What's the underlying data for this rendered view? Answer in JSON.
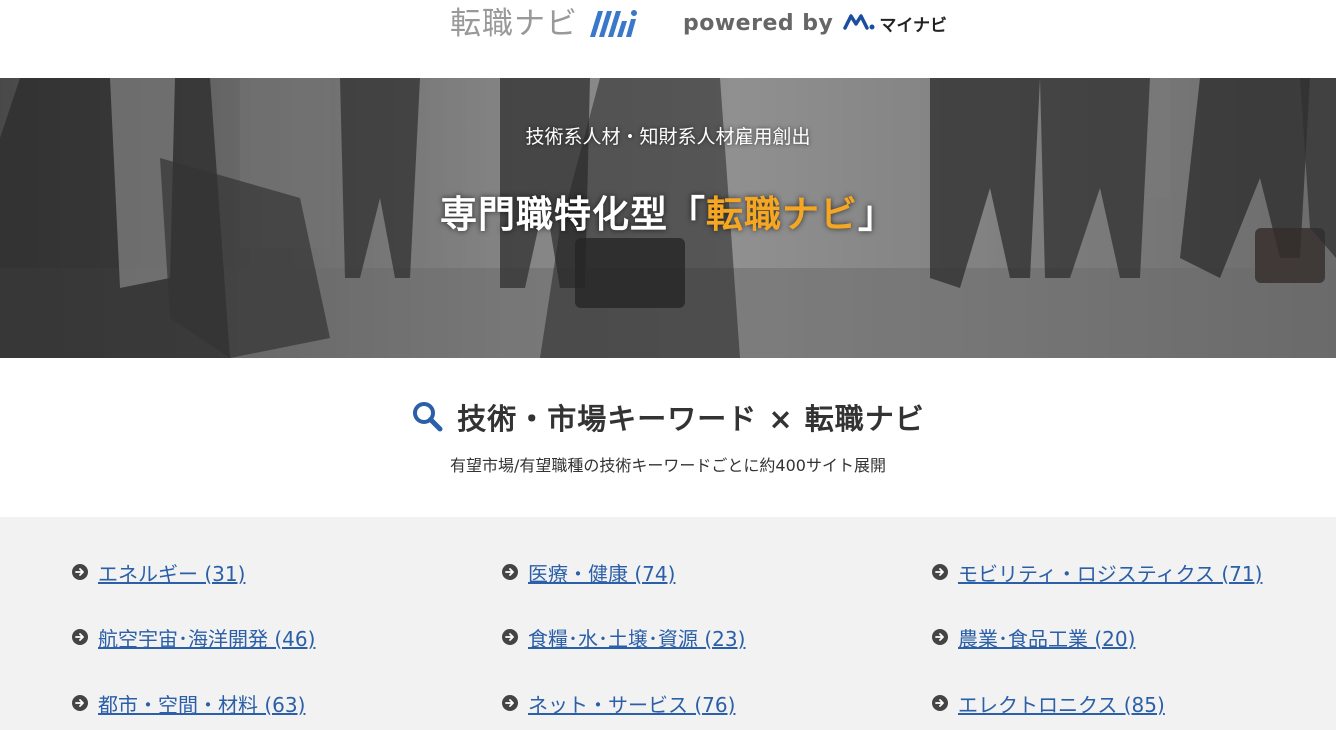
{
  "header": {
    "logo_text": "転職ナビ",
    "logo_mark_icon": "tenshoku-navi-mark-icon",
    "powered_text": "powered by",
    "partner_logo_text": "マイナビ",
    "partner_logo_icon": "mynavi-mark-icon"
  },
  "hero": {
    "subtitle": "技術系人材・知財系人材雇用創出",
    "title_prefix": "専門職特化型「",
    "title_accent": "転職ナビ",
    "title_suffix": "」",
    "accent_color": "#f5a623"
  },
  "section": {
    "icon": "search-icon",
    "title": "技術・市場キーワード × 転職ナビ",
    "subtitle": "有望市場/有望職種の技術キーワードごとに約400サイト展開"
  },
  "categories": {
    "bullet_icon": "arrow-circle-icon",
    "link_color": "#2b5fa8",
    "items": [
      {
        "label": "エネルギー (31)"
      },
      {
        "label": "医療・健康 (74)"
      },
      {
        "label": "モビリティ・ロジスティクス (71)"
      },
      {
        "label": "航空宇宙･海洋開発 (46)"
      },
      {
        "label": "食糧･水･土壌･資源 (23)"
      },
      {
        "label": "農業･食品工業 (20)"
      },
      {
        "label": "都市・空間・材料 (63)"
      },
      {
        "label": "ネット・サービス (76)"
      },
      {
        "label": "エレクトロニクス (85)"
      }
    ]
  }
}
